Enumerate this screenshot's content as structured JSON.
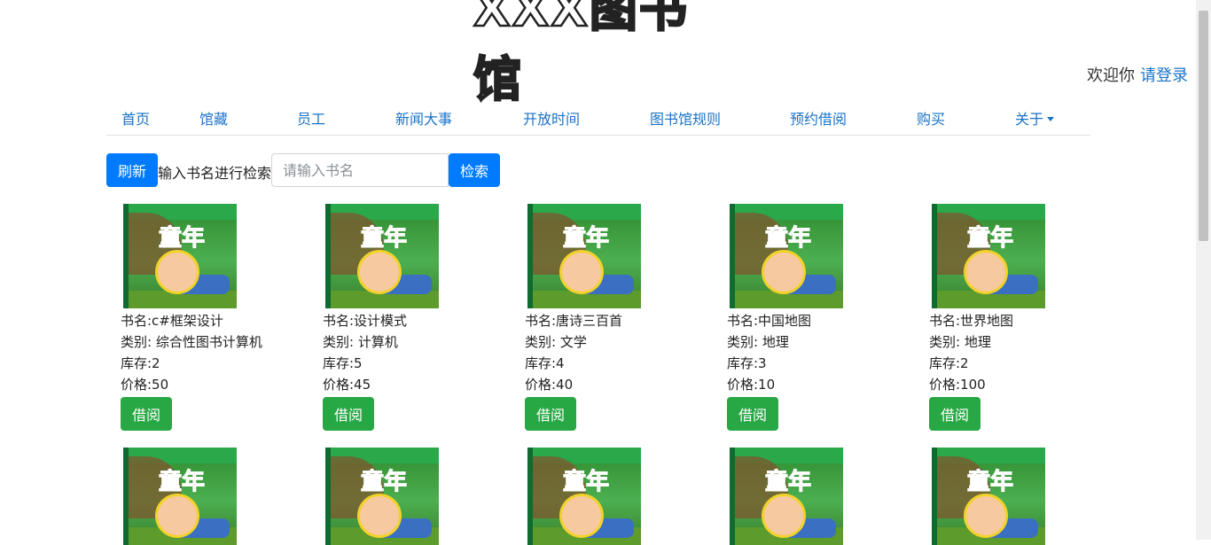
{
  "site": {
    "logo_text": "XXX图书馆"
  },
  "header": {
    "welcome": "欢迎你",
    "login_link": "请登录"
  },
  "nav": {
    "items": [
      {
        "label": "首页"
      },
      {
        "label": "馆藏"
      },
      {
        "label": "员工"
      },
      {
        "label": "新闻大事"
      },
      {
        "label": "开放时间"
      },
      {
        "label": "图书馆规则"
      },
      {
        "label": "预约借阅"
      },
      {
        "label": "购买"
      },
      {
        "label": "关于"
      }
    ]
  },
  "search": {
    "refresh_label": "刷新",
    "prompt": "输入书名进行检索",
    "placeholder": "请输入书名",
    "value": "",
    "search_label": "检索"
  },
  "books": [
    {
      "name": "书名:c#框架设计",
      "category": "类别: 综合性图书计算机",
      "stock": "库存:2",
      "price": "价格:50",
      "borrow": "借阅",
      "cover_text": "童年"
    },
    {
      "name": "书名:设计模式",
      "category": "类别: 计算机",
      "stock": "库存:5",
      "price": "价格:45",
      "borrow": "借阅",
      "cover_text": "童年"
    },
    {
      "name": "书名:唐诗三百首",
      "category": "类别: 文学",
      "stock": "库存:4",
      "price": "价格:40",
      "borrow": "借阅",
      "cover_text": "童年"
    },
    {
      "name": "书名:中国地图",
      "category": "类别: 地理",
      "stock": "库存:3",
      "price": "价格:10",
      "borrow": "借阅",
      "cover_text": "童年"
    },
    {
      "name": "书名:世界地图",
      "category": "类别: 地理",
      "stock": "库存:2",
      "price": "价格:100",
      "borrow": "借阅",
      "cover_text": "童年"
    }
  ],
  "second_row_covers": [
    "童年",
    "童年",
    "童年",
    "童年",
    "童年"
  ],
  "colors": {
    "link": "#1a73c8",
    "primary": "#007bff",
    "success": "#28a745"
  }
}
